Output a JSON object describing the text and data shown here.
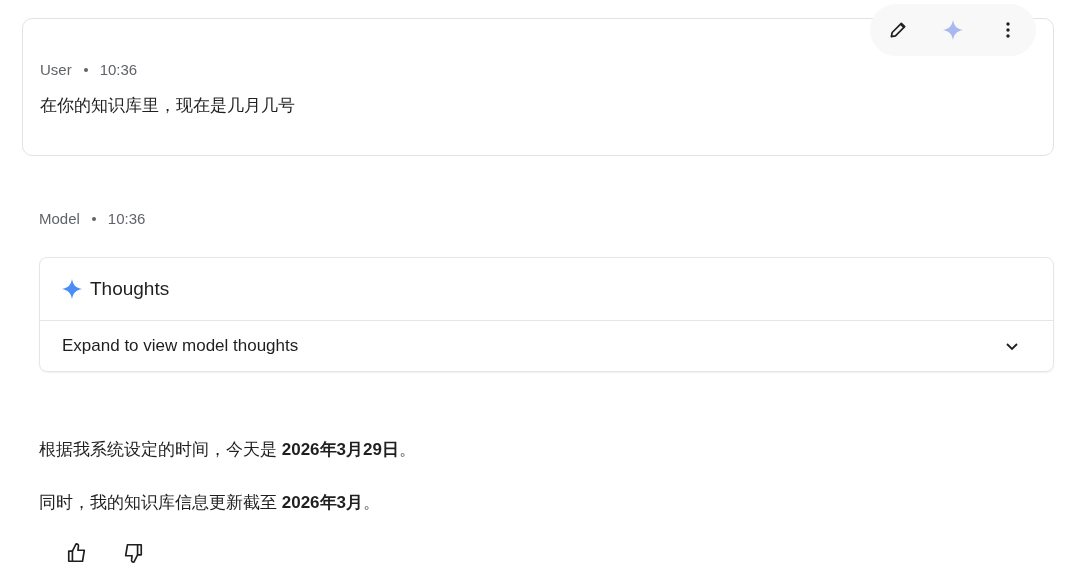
{
  "user_turn": {
    "author": "User",
    "time": "10:36",
    "text": "在你的知识库里，现在是几月几号"
  },
  "model_turn": {
    "author": "Model",
    "time": "10:36",
    "thoughts": {
      "title": "Thoughts",
      "toggle_label": "Expand to view model thoughts",
      "expanded": false
    },
    "paragraphs": [
      "根据我系统设定的时间，今天是 **2026年3月29日**。",
      "同时，我的知识库信息更新截至 **2026年3月**。"
    ]
  }
}
